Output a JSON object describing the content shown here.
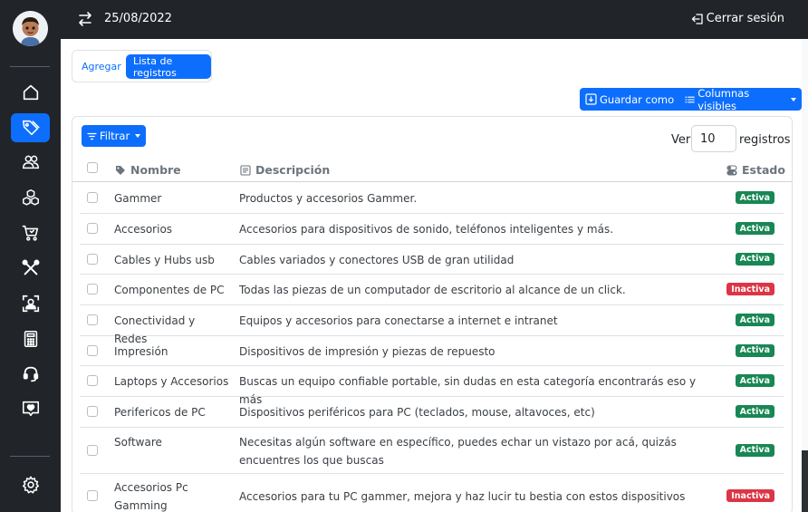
{
  "header": {
    "date": "25/08/2022",
    "logout_label": "Cerrar sesión"
  },
  "sidebar": {
    "items": [
      {
        "icon": "house-icon",
        "active": false
      },
      {
        "icon": "tags-icon",
        "active": true
      },
      {
        "icon": "people-icon",
        "active": false
      },
      {
        "icon": "boxes-icon",
        "active": false
      },
      {
        "icon": "cart-icon",
        "active": false
      },
      {
        "icon": "tools-icon",
        "active": false
      },
      {
        "icon": "person-badge-icon",
        "active": false
      },
      {
        "icon": "calculator-icon",
        "active": false
      },
      {
        "icon": "headset-icon",
        "active": false
      },
      {
        "icon": "heart-chat-icon",
        "active": false
      },
      {
        "icon": "gear-icon",
        "active": false
      }
    ]
  },
  "tabs": {
    "add_label": "Agregar",
    "list_label": "Lista de registros"
  },
  "toolbar": {
    "save_as_label": "Guardar como",
    "columns_label": "Columnas visibles",
    "filter_label": "Filtrar"
  },
  "pager": {
    "prefix": "Ver",
    "value": "10",
    "suffix": "registros"
  },
  "table": {
    "columns": {
      "name": "Nombre",
      "description": "Descripción",
      "status": "Estado"
    },
    "rows": [
      {
        "name": "Gammer",
        "description": "Productos y accesorios Gammer.",
        "status": "Activa",
        "active": true
      },
      {
        "name": "Accesorios",
        "description": "Accesorios para dispositivos de sonido, teléfonos inteligentes y más.",
        "status": "Activa",
        "active": true
      },
      {
        "name": "Cables y Hubs usb",
        "description": "Cables variados y conectores USB de gran utilidad",
        "status": "Activa",
        "active": true
      },
      {
        "name": "Componentes de PC",
        "description": "Todas las piezas de un computador de escritorio al alcance de un click.",
        "status": "Inactiva",
        "active": false
      },
      {
        "name": "Conectividad y Redes",
        "description": "Equipos y accesorios para conectarse a internet e intranet",
        "status": "Activa",
        "active": true
      },
      {
        "name": "Impresión",
        "description": "Dispositivos de impresión y piezas de repuesto",
        "status": "Activa",
        "active": true
      },
      {
        "name": "Laptops y Accesorios",
        "description": "Buscas un equipo confiable portable, sin dudas en esta categoría encontrarás eso y más",
        "status": "Activa",
        "active": true
      },
      {
        "name": "Perifericos de PC",
        "description": "Dispositivos periféricos para PC (teclados, mouse, altavoces, etc)",
        "status": "Activa",
        "active": true
      },
      {
        "name": "Software",
        "description": "Necesitas algún software en específico, puedes echar un vistazo por acá, quizás encuentres los que buscas",
        "status": "Activa",
        "active": true
      },
      {
        "name": "Accesorios Pc Gamming",
        "description": "Accesorios para tu PC gammer, mejora y haz lucir tu bestia con estos dispositivos",
        "status": "Inactiva",
        "active": false
      }
    ]
  }
}
